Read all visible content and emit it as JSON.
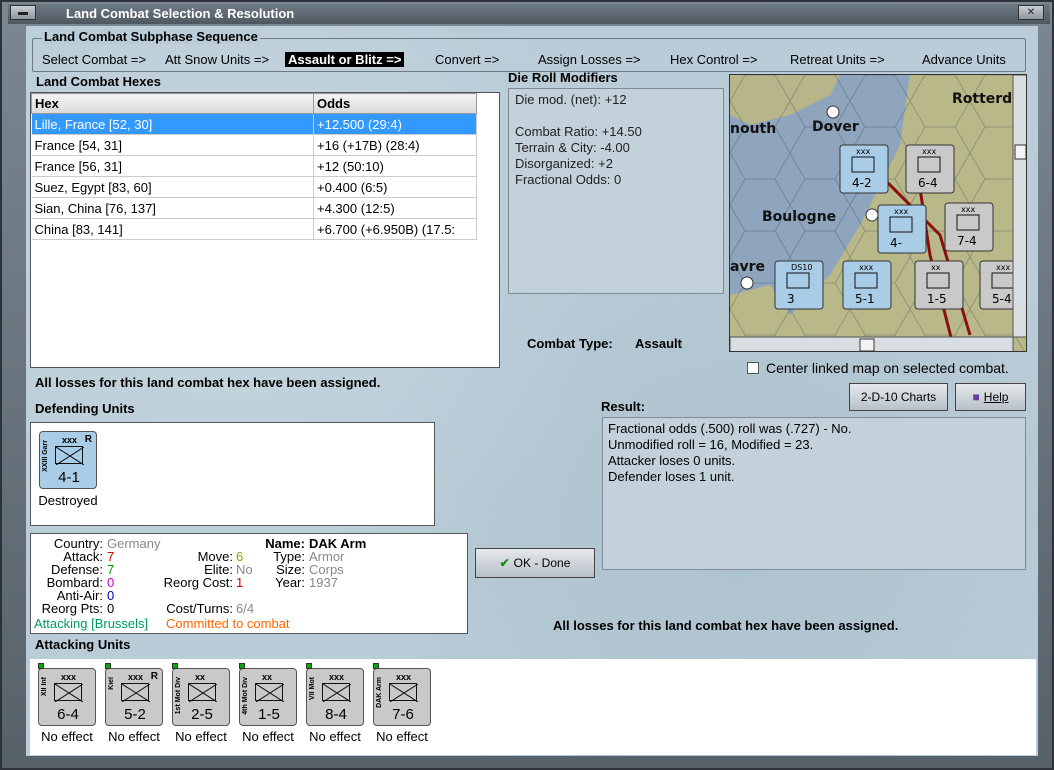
{
  "window": {
    "title": "Land Combat Selection & Resolution"
  },
  "subphase": {
    "heading": "Land Combat Subphase Sequence",
    "steps": [
      {
        "label": "Select Combat =>"
      },
      {
        "label": "Att Snow Units =>"
      },
      {
        "label": "Assault or Blitz =>"
      },
      {
        "label": "Convert =>"
      },
      {
        "label": "Assign Losses =>"
      },
      {
        "label": "Hex Control =>"
      },
      {
        "label": "Retreat Units =>"
      },
      {
        "label": "Advance Units"
      }
    ],
    "active_index": 2
  },
  "hexes": {
    "heading": "Land Combat Hexes",
    "columns": [
      "Hex",
      "Odds"
    ],
    "rows": [
      {
        "hex": "Lille, France [52, 30]",
        "odds": "+12.500 (29:4)"
      },
      {
        "hex": "France [54, 31]",
        "odds": "+16 (+17B) (28:4)"
      },
      {
        "hex": "France [56, 31]",
        "odds": "+12 (50:10)"
      },
      {
        "hex": "Suez, Egypt [83, 60]",
        "odds": "+0.400 (6:5)"
      },
      {
        "hex": "Sian, China [76, 137]",
        "odds": "+4.300 (12:5)"
      },
      {
        "hex": "China [83, 141]",
        "odds": "+6.700 (+6.950B) (17.5:"
      }
    ],
    "selected_index": 0
  },
  "die_roll": {
    "heading": "Die Roll Modifiers",
    "lines": [
      "Die mod. (net): +12",
      "",
      "Combat Ratio: +14.50",
      "Terrain & City: -4.00",
      "Disorganized: +2",
      "Fractional Odds: 0"
    ]
  },
  "map": {
    "labels": [
      "Dover",
      "Rotterd",
      "nouth",
      "Boulogne",
      "avre"
    ],
    "center_checkbox_label": "Center linked map on selected combat.",
    "center_checked": false,
    "counters": [
      {
        "corps": "xxx",
        "value": "4-2",
        "color": "#a9cde6"
      },
      {
        "corps": "xxx",
        "value": "6-4",
        "color": "#c9c9c9"
      },
      {
        "corps": "xxx",
        "value": "4-",
        "color": "#a9cde6"
      },
      {
        "corps": "xxx",
        "value": "7-4",
        "color": "#c9c9c9"
      },
      {
        "corps": "DS10",
        "value": "3",
        "color": "#a9cde6"
      },
      {
        "corps": "xxx",
        "value": "5-1",
        "color": "#a9cde6"
      },
      {
        "corps": "xx",
        "value": "1-5",
        "color": "#c9c9c9"
      },
      {
        "corps": "xxx",
        "value": "5-4",
        "color": "#c9c9c9"
      }
    ]
  },
  "combat_type": {
    "label": "Combat Type:",
    "value": "Assault"
  },
  "losses_assigned_msg": "All losses for this land combat hex have been assigned.",
  "buttons": {
    "charts": "2-D-10 Charts",
    "help": "Help",
    "ok": "OK - Done"
  },
  "defending": {
    "heading": "Defending Units",
    "units": [
      {
        "corps": "xxx",
        "side": "XXIII Garr",
        "rating": "R",
        "strength": "4-1",
        "status": "Destroyed",
        "color": "#a9cde6"
      }
    ]
  },
  "result": {
    "heading": "Result:",
    "lines": [
      "Fractional odds (.500) roll was (.727)  - No.",
      "Unmodified roll = 16, Modified = 23.",
      "Attacker loses 0 units.",
      "Defender loses 1 unit."
    ]
  },
  "unit_info": {
    "country_label": "Country:",
    "country": "Germany",
    "attack_label": "Attack:",
    "attack": "7",
    "defense_label": "Defense:",
    "defense": "7",
    "bombard_label": "Bombard:",
    "bombard": "0",
    "antiair_label": "Anti-Air:",
    "antiair": "0",
    "reorg_pts_label": "Reorg Pts:",
    "reorg_pts": "0",
    "move_label": "Move:",
    "move": "6",
    "elite_label": "Elite:",
    "elite": "No",
    "reorg_cost_label": "Reorg Cost:",
    "reorg_cost": "1",
    "cost_turns_label": "Cost/Turns:",
    "cost_turns": "6/4",
    "name_label": "Name:",
    "name": "DAK Arm",
    "type_label": "Type:",
    "type": "Armor",
    "size_label": "Size:",
    "size": "Corps",
    "year_label": "Year:",
    "year": "1937",
    "attacking_text": "Attacking [Brussels]",
    "committed_text": "Committed to combat",
    "colors": {
      "attack": "#cc0000",
      "defense": "#009900",
      "bombard": "#cc00cc",
      "antiair": "#0000cc",
      "move": "#999900",
      "reorg_cost": "#cc0000",
      "attacking": "#009966",
      "committed": "#ff6600"
    }
  },
  "attacking": {
    "heading": "Attacking Units",
    "units": [
      {
        "corps": "xxx",
        "side": "XII Inf",
        "rating": "",
        "strength": "6-4",
        "effect": "No effect",
        "color": "#c9c9c9"
      },
      {
        "corps": "xxx",
        "side": "Kiel",
        "rating": "R",
        "strength": "5-2",
        "effect": "No effect",
        "color": "#c9c9c9"
      },
      {
        "corps": "xx",
        "side": "1st Mot Div",
        "rating": "",
        "strength": "2-5",
        "effect": "No effect",
        "color": "#c9c9c9"
      },
      {
        "corps": "xx",
        "side": "4th Mot Div",
        "rating": "",
        "strength": "1-5",
        "effect": "No effect",
        "color": "#c9c9c9"
      },
      {
        "corps": "xxx",
        "side": "VII Mot",
        "rating": "",
        "strength": "8-4",
        "effect": "No effect",
        "color": "#c9c9c9"
      },
      {
        "corps": "xxx",
        "side": "DAK Arm",
        "rating": "",
        "strength": "7-6",
        "effect": "No effect",
        "color": "#c9c9c9"
      }
    ]
  }
}
